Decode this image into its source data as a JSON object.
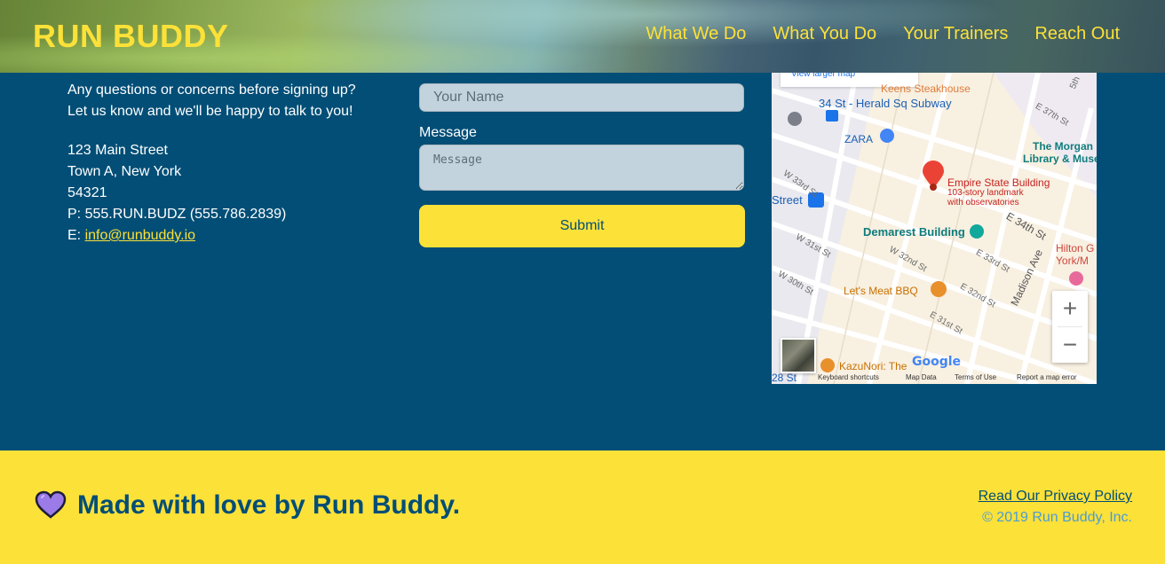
{
  "header": {
    "logo": "RUN BUDDY",
    "nav": [
      "What We Do",
      "What You Do",
      "Your Trainers",
      "Reach Out"
    ]
  },
  "contact": {
    "intro_line1": "Any questions or concerns before signing up?",
    "intro_line2": "Let us know and we'll be happy to talk to you!",
    "street": "123 Main Street",
    "city": "Town A, New York",
    "zip": "54321",
    "phone": "P: 555.RUN.BUDZ (555.786.2839)",
    "email_prefix": "E: ",
    "email": "info@runbuddy.io"
  },
  "form": {
    "name_label": "Your Name",
    "name_placeholder": "Your Name",
    "message_label": "Message",
    "message_placeholder": "Message",
    "submit_label": "Submit"
  },
  "map": {
    "view_larger": "View larger map",
    "labels": {
      "keens": "Keens Steakhouse",
      "subway": "34 St - Herald Sq Subway",
      "zara": "ZARA",
      "morgan": "The Morgan",
      "morgan2": "Library & Museum",
      "esb": "Empire State Building",
      "esb_sub1": "103-story landmark",
      "esb_sub2": "with observatories",
      "street": "Street",
      "demarest": "Demarest Building",
      "hilton": "Hilton G",
      "hilton2": "York/M",
      "letsmeat": "Let's Meat BBQ",
      "kazunori": "KazuNori: The",
      "w33": "W 33rd St",
      "w32": "W 32nd St",
      "w31": "W 31st St",
      "w30": "W 30th St",
      "e34": "E 34th St",
      "e33": "E 33rd St",
      "e32": "E 32nd St",
      "e31": "E 31st St",
      "e37": "E 37th St",
      "madison": "Madison Ave",
      "st28": "28 St",
      "fifth": "5th"
    },
    "zoom_in": "+",
    "zoom_out": "−",
    "google": "Google",
    "footer": {
      "keyboard": "Keyboard shortcuts",
      "map_data": "Map Data",
      "terms": "Terms of Use",
      "report": "Report a map error"
    }
  },
  "footer": {
    "tagline": "Made with love by Run Buddy.",
    "privacy": "Read Our Privacy Policy",
    "copyright": "© 2019 Run Buddy, Inc."
  },
  "colors": {
    "primary": "#024e76",
    "accent": "#fce138",
    "link_blue": "#4b9cd3"
  }
}
